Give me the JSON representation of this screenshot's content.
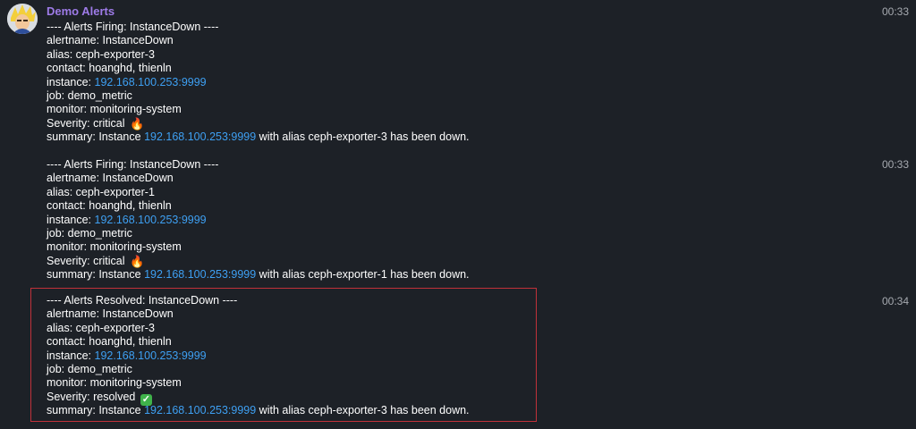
{
  "chat": {
    "sender_name": "Demo Alerts",
    "avatar_icon": "user-avatar-icon"
  },
  "messages": [
    {
      "time": "00:33",
      "header": "---- Alerts Firing: InstanceDown ----",
      "alertname": "alertname: InstanceDown",
      "alias": "alias: ceph-exporter-3",
      "contact": "contact: hoanghd, thienln",
      "instance_label": "instance: ",
      "instance_link": "192.168.100.253:9999",
      "job": "job: demo_metric",
      "monitor": "monitor: monitoring-system",
      "severity": "Severity: critical",
      "severity_emoji": "🔥",
      "summary_prefix": "summary: Instance ",
      "summary_link": "192.168.100.253:9999",
      "summary_suffix": " with alias ceph-exporter-3 has been down."
    },
    {
      "time": "00:33",
      "header": "---- Alerts Firing: InstanceDown ----",
      "alertname": "alertname: InstanceDown",
      "alias": "alias: ceph-exporter-1",
      "contact": "contact: hoanghd, thienln",
      "instance_label": "instance: ",
      "instance_link": "192.168.100.253:9999",
      "job": "job: demo_metric",
      "monitor": "monitor: monitoring-system",
      "severity": "Severity: critical",
      "severity_emoji": "🔥",
      "summary_prefix": "summary: Instance ",
      "summary_link": "192.168.100.253:9999",
      "summary_suffix": " with alias ceph-exporter-1 has been down."
    },
    {
      "time": "00:34",
      "header": "---- Alerts Resolved: InstanceDown ----",
      "alertname": "alertname: InstanceDown",
      "alias": "alias: ceph-exporter-3",
      "contact": "contact: hoanghd, thienln",
      "instance_label": "instance: ",
      "instance_link": "192.168.100.253:9999",
      "job": "job: demo_metric",
      "monitor": "monitor: monitoring-system",
      "severity": "Severity: resolved",
      "severity_emoji": "✓",
      "summary_prefix": "summary: Instance ",
      "summary_link": "192.168.100.253:9999",
      "summary_suffix": " with alias ceph-exporter-3 has been down."
    }
  ],
  "colors": {
    "background": "#1d2127",
    "sender": "#9e7be8",
    "link": "#3ea0f3",
    "highlight_border": "#c0313a",
    "timestamp": "#a6aab0"
  }
}
